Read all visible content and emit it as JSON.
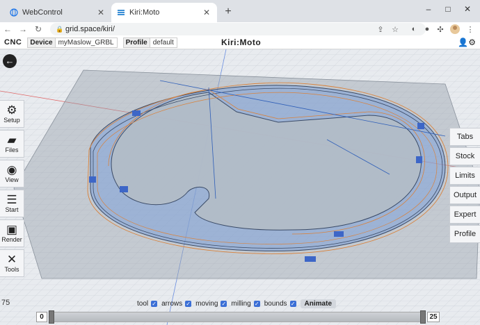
{
  "browser": {
    "tabs": [
      {
        "title": "WebControl",
        "active": false
      },
      {
        "title": "Kiri:Moto",
        "active": true
      }
    ],
    "url": "grid.space/kiri/"
  },
  "kiri": {
    "mode": "CNC",
    "device_label": "Device",
    "device_value": "myMaslow_GRBL",
    "profile_label": "Profile",
    "profile_value": "default",
    "logo": "Kiri:Moto"
  },
  "left_menu": [
    {
      "label": "Setup",
      "icon": "gear-icon"
    },
    {
      "label": "Files",
      "icon": "folder-icon"
    },
    {
      "label": "View",
      "icon": "eye-icon"
    },
    {
      "label": "Start",
      "icon": "menu-icon"
    },
    {
      "label": "Render",
      "icon": "render-icon"
    },
    {
      "label": "Tools",
      "icon": "tools-icon"
    }
  ],
  "right_menu": [
    {
      "label": "Tabs"
    },
    {
      "label": "Stock"
    },
    {
      "label": "Limits"
    },
    {
      "label": "Output"
    },
    {
      "label": "Expert"
    },
    {
      "label": "Profile"
    }
  ],
  "toggles": [
    {
      "label": "tool",
      "checked": true
    },
    {
      "label": "arrows",
      "checked": true
    },
    {
      "label": "moving",
      "checked": true
    },
    {
      "label": "milling",
      "checked": true
    },
    {
      "label": "bounds",
      "checked": true
    }
  ],
  "animate_label": "Animate",
  "layer_slider": {
    "min_label": "0",
    "max_label": "25",
    "start": 0,
    "end": 1
  },
  "colors": {
    "accent": "#3b6fd6",
    "toolpath_orange": "#d9823b",
    "toolpath_dark": "#3a4a66",
    "part_blue": "#7ea1d8"
  }
}
